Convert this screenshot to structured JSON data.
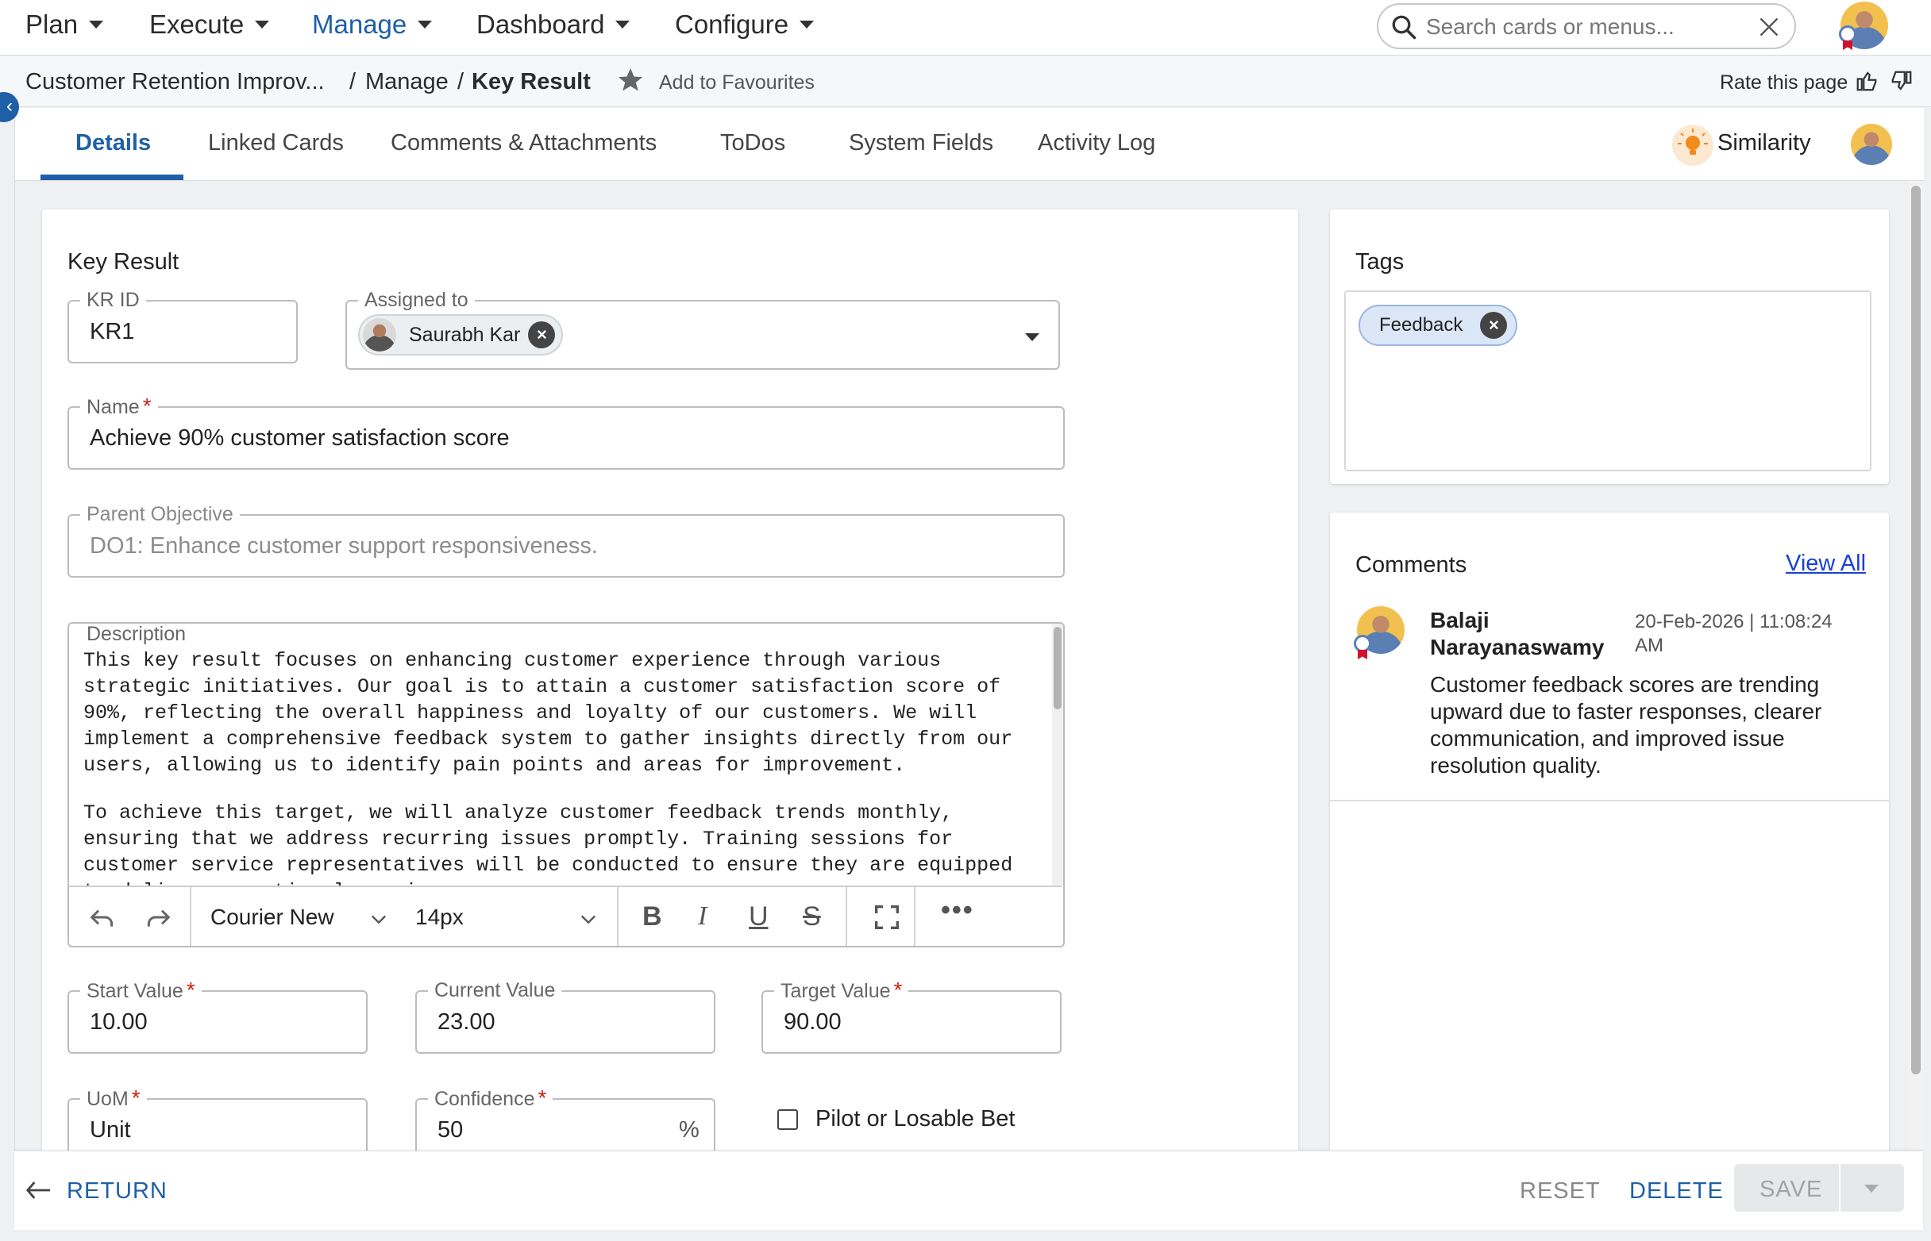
{
  "nav": {
    "items": [
      {
        "label": "Plan"
      },
      {
        "label": "Execute"
      },
      {
        "label": "Manage"
      },
      {
        "label": "Dashboard"
      },
      {
        "label": "Configure"
      }
    ],
    "search_placeholder": "Search cards or menus..."
  },
  "breadcrumb": {
    "card": "Customer Retention Improv...",
    "sep1": "/",
    "module": "Manage",
    "sep2": "/",
    "current": "Key Result",
    "favourites": "Add to Favourites",
    "rate": "Rate this page"
  },
  "tabs": [
    {
      "label": "Details"
    },
    {
      "label": "Linked Cards"
    },
    {
      "label": "Comments & Attachments"
    },
    {
      "label": "ToDos"
    },
    {
      "label": "System Fields"
    },
    {
      "label": "Activity Log"
    }
  ],
  "similarity": "Similarity",
  "form": {
    "title": "Key Result",
    "kr_id": {
      "label": "KR ID",
      "value": "KR1"
    },
    "assigned_to": {
      "label": "Assigned to",
      "value": "Saurabh Kar"
    },
    "name": {
      "label": "Name",
      "required": "*",
      "value": "Achieve 90% customer satisfaction score"
    },
    "parent": {
      "label": "Parent Objective",
      "value": "DO1: Enhance customer support responsiveness."
    },
    "description": {
      "label": "Description",
      "p1": "This key result focuses on enhancing customer experience through various strategic initiatives. Our goal is to attain a customer satisfaction score of 90%, reflecting the overall happiness and loyalty of our customers. We will implement a comprehensive feedback system to gather insights directly from our users, allowing us to identify pain points and areas for improvement.",
      "p2": "To achieve this target, we will analyze customer feedback trends monthly, ensuring that we address recurring issues promptly. Training sessions for customer service representatives will be conducted to ensure they are equipped to deliver exceptional service."
    },
    "toolbar": {
      "font": "Courier New",
      "size": "14px"
    },
    "start_value": {
      "label": "Start Value",
      "required": "*",
      "value": "10.00"
    },
    "current_value": {
      "label": "Current Value",
      "value": "23.00"
    },
    "target_value": {
      "label": "Target Value",
      "required": "*",
      "value": "90.00"
    },
    "uom": {
      "label": "UoM",
      "required": "*",
      "value": "Unit"
    },
    "confidence": {
      "label": "Confidence",
      "required": "*",
      "value": "50",
      "suffix": "%"
    },
    "pilot": {
      "label": "Pilot or Losable Bet"
    }
  },
  "tags": {
    "title": "Tags",
    "items": [
      {
        "label": "Feedback"
      }
    ]
  },
  "comments": {
    "title": "Comments",
    "view_all": "View All",
    "items": [
      {
        "author_line1": "Balaji",
        "author_line2": "Narayanaswamy",
        "date_line1": "20-Feb-2026 | 11:08:24",
        "date_line2": "AM",
        "text": "Customer feedback scores are trending upward due to faster responses, clearer communication, and improved issue resolution quality."
      }
    ]
  },
  "footer": {
    "return": "RETURN",
    "reset": "RESET",
    "delete": "DELETE",
    "save": "SAVE"
  },
  "colors": {
    "accent": "#1f5fa8",
    "required": "#cc2211",
    "similarity_bulb": "#f28a1c"
  }
}
